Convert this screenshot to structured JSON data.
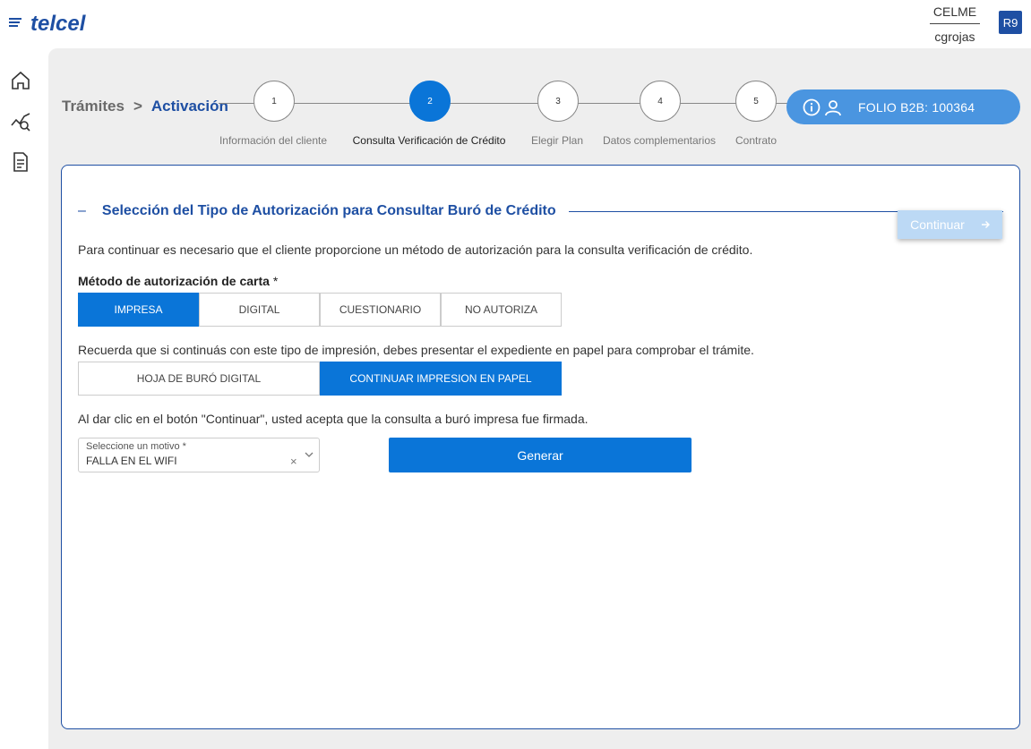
{
  "header": {
    "logo_text": "telcel",
    "user_company": "CELME",
    "user_name": "cgrojas",
    "user_badge": "R9"
  },
  "sidebar": {
    "items": [
      {
        "icon": "home-icon"
      },
      {
        "icon": "chart-search-icon"
      },
      {
        "icon": "document-icon"
      }
    ]
  },
  "breadcrumb": {
    "root": "Trámites",
    "separator": ">",
    "current": "Activación"
  },
  "stepper": {
    "steps": [
      {
        "number": "1",
        "label": "Información del cliente",
        "active": false
      },
      {
        "number": "2",
        "label": "Consulta Verificación de Crédito",
        "active": true
      },
      {
        "number": "3",
        "label": "Elegir Plan",
        "active": false
      },
      {
        "number": "4",
        "label": "Datos complementarios",
        "active": false
      },
      {
        "number": "5",
        "label": "Contrato",
        "active": false
      }
    ]
  },
  "folio": {
    "text": "FOLIO B2B: 100364"
  },
  "card": {
    "title": "Selección del Tipo de Autorización para Consultar Buró de Crédito",
    "collapse_symbol": "–",
    "continue_button": "Continuar",
    "intro": "Para continuar es necesario que el cliente proporcione un método de autorización para la consulta verificación de crédito.",
    "method_label": "Método de autorización de carta",
    "required_mark": "*",
    "methods": [
      {
        "label": "IMPRESA",
        "selected": true
      },
      {
        "label": "DIGITAL",
        "selected": false
      },
      {
        "label": "CUESTIONARIO",
        "selected": false
      },
      {
        "label": "NO AUTORIZA",
        "selected": false
      }
    ],
    "print_note": "Recuerda que si continuás con este tipo de impresión, debes presentar el expediente en papel para comprobar el trámite.",
    "print_options": [
      {
        "label": "HOJA DE BURÓ DIGITAL",
        "selected": false
      },
      {
        "label": "CONTINUAR IMPRESION EN PAPEL",
        "selected": true
      }
    ],
    "accept_note": "Al dar clic en el botón \"Continuar\", usted acepta que la consulta a buró impresa fue firmada.",
    "reason_select": {
      "label": "Seleccione un motivo *",
      "value": "FALLA EN EL WIFI",
      "clear": "×"
    },
    "generate_button": "Generar"
  },
  "colors": {
    "brand_blue": "#1e4fa3",
    "primary_blue": "#0a75d8",
    "folio_blue": "#4a95e0",
    "disabled_blue": "#bcd9f5"
  }
}
